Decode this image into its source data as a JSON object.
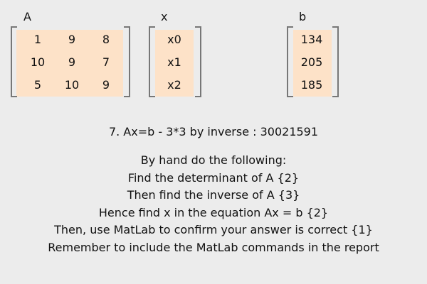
{
  "labels": {
    "A": "A",
    "x": "x",
    "b": "b"
  },
  "matrix_A": [
    [
      "1",
      "9",
      "8"
    ],
    [
      "10",
      "9",
      "7"
    ],
    [
      "5",
      "10",
      "9"
    ]
  ],
  "vector_x": [
    "x0",
    "x1",
    "x2"
  ],
  "vector_b": [
    "134",
    "205",
    "185"
  ],
  "heading": "7. Ax=b - 3*3 by inverse : 30021591",
  "instructions": [
    "By hand do the following:",
    "Find the determinant of A {2}",
    "Then find the inverse of A {3}",
    "Hence find x in the equation Ax = b {2}",
    "Then, use MatLab to confirm your answer is correct {1}",
    "Remember to include the MatLab commands in the report"
  ],
  "colors": {
    "background": "#ececec",
    "cell_fill": "#fde2c8",
    "bracket": "#777777"
  }
}
